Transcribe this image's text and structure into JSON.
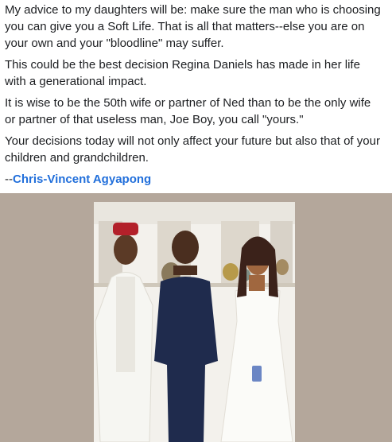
{
  "post": {
    "paragraphs": [
      "My advice to my daughters will be: make sure the man who is choosing you can give you a Soft Life. That is all that matters--else you are on your own and your \"bloodline\" may suffer.",
      "This could be the best decision Regina Daniels has made in her life with a generational impact.",
      "It is wise to be the 50th wife or partner of Ned than to be the only wife or partner of that useless man, Joe Boy, you call \"yours.\"",
      "Your decisions today will not only affect your future but also that of your children and grandchildren."
    ],
    "author_prefix": "--",
    "author_name": "Chris-Vincent Agyapong"
  },
  "colors": {
    "text": "#1c1e21",
    "link": "#216fdb",
    "photo_background": "#b4a79b"
  },
  "photo": {
    "subject": "group-photo-three-people"
  }
}
